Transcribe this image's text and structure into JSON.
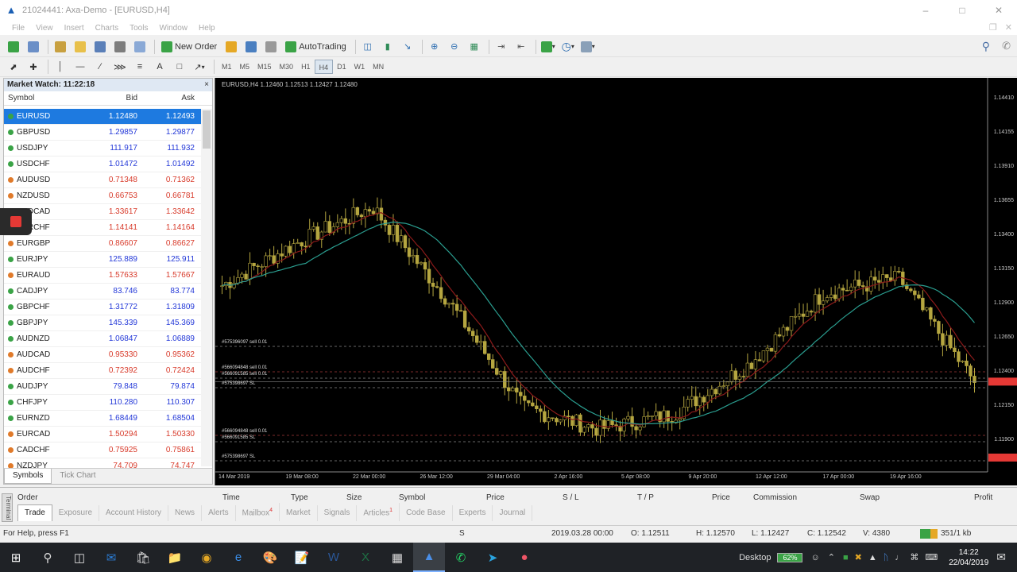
{
  "window": {
    "title": "21024441: Axa-Demo - [EURUSD,H4]",
    "buttons": [
      "–",
      "□",
      "✕"
    ]
  },
  "menu": [
    "File",
    "View",
    "Insert",
    "Charts",
    "Tools",
    "Window",
    "Help"
  ],
  "toolbar": {
    "new_order": "New Order",
    "autotrading": "AutoTrading",
    "timeframes": [
      "M1",
      "M5",
      "M15",
      "M30",
      "H1",
      "H4",
      "D1",
      "W1",
      "MN"
    ],
    "active_timeframe": "H4"
  },
  "market_watch": {
    "title": "Market Watch: 11:22:18",
    "columns": [
      "Symbol",
      "Bid",
      "Ask"
    ],
    "rows": [
      {
        "symbol": "EURUSD",
        "bid": "1.12480",
        "ask": "1.12493",
        "up": true
      },
      {
        "symbol": "GBPUSD",
        "bid": "1.29857",
        "ask": "1.29877",
        "up": true
      },
      {
        "symbol": "USDJPY",
        "bid": "111.917",
        "ask": "111.932",
        "up": true
      },
      {
        "symbol": "USDCHF",
        "bid": "1.01472",
        "ask": "1.01492",
        "up": true
      },
      {
        "symbol": "AUDUSD",
        "bid": "0.71348",
        "ask": "0.71362",
        "up": false
      },
      {
        "symbol": "NZDUSD",
        "bid": "0.66753",
        "ask": "0.66781",
        "up": false
      },
      {
        "symbol": "USDCAD",
        "bid": "1.33617",
        "ask": "1.33642",
        "up": false
      },
      {
        "symbol": "EURCHF",
        "bid": "1.14141",
        "ask": "1.14164",
        "up": false
      },
      {
        "symbol": "EURGBP",
        "bid": "0.86607",
        "ask": "0.86627",
        "up": false
      },
      {
        "symbol": "EURJPY",
        "bid": "125.889",
        "ask": "125.911",
        "up": true
      },
      {
        "symbol": "EURAUD",
        "bid": "1.57633",
        "ask": "1.57667",
        "up": false
      },
      {
        "symbol": "CADJPY",
        "bid": "83.746",
        "ask": "83.774",
        "up": true
      },
      {
        "symbol": "GBPCHF",
        "bid": "1.31772",
        "ask": "1.31809",
        "up": true
      },
      {
        "symbol": "GBPJPY",
        "bid": "145.339",
        "ask": "145.369",
        "up": true
      },
      {
        "symbol": "AUDNZD",
        "bid": "1.06847",
        "ask": "1.06889",
        "up": true
      },
      {
        "symbol": "AUDCAD",
        "bid": "0.95330",
        "ask": "0.95362",
        "up": false
      },
      {
        "symbol": "AUDCHF",
        "bid": "0.72392",
        "ask": "0.72424",
        "up": false
      },
      {
        "symbol": "AUDJPY",
        "bid": "79.848",
        "ask": "79.874",
        "up": true
      },
      {
        "symbol": "CHFJPY",
        "bid": "110.280",
        "ask": "110.307",
        "up": true
      },
      {
        "symbol": "EURNZD",
        "bid": "1.68449",
        "ask": "1.68504",
        "up": true
      },
      {
        "symbol": "EURCAD",
        "bid": "1.50294",
        "ask": "1.50330",
        "up": false
      },
      {
        "symbol": "CADCHF",
        "bid": "0.75925",
        "ask": "0.75861",
        "up": false
      },
      {
        "symbol": "NZDJPY",
        "bid": "74.709",
        "ask": "74.747",
        "up": false
      }
    ],
    "tabs": [
      "Symbols",
      "Tick Chart"
    ],
    "active_tab": "Symbols"
  },
  "chart": {
    "header": "EURUSD,H4  1.12460 1.12513 1.12427 1.12480",
    "y_labels": [
      "1.14410",
      "1.14155",
      "1.13910",
      "1.13655",
      "1.13400",
      "1.13150",
      "1.12900",
      "1.12650",
      "1.12400",
      "1.12150",
      "1.11900"
    ],
    "x_labels": [
      "14 Mar 2019",
      "19 Mar 08:00",
      "22 Mar 00:00",
      "26 Mar 12:00",
      "29 Mar 04:00",
      "2 Apr 16:00",
      "5 Apr 08:00",
      "9 Apr 20:00",
      "12 Apr 12:00",
      "17 Apr 00:00",
      "19 Apr 16:00"
    ],
    "order_labels": [
      "#575396097 sell 0.01",
      "#566094848 sell 0.01",
      "#566091585 sell 0.01",
      "#575398697 SL",
      "#566094848 sell 0.01",
      "#566091585 SL",
      "#575398697 SL"
    ],
    "current_price_color": "#e53935",
    "candle_color": "#b5a640",
    "ma_fast_color": "#8b1a1a",
    "ma_slow_color": "#2a9d8f"
  },
  "chart_data": {
    "type": "line",
    "title": "",
    "symbol": "EURUSD",
    "timeframe": "H4",
    "x": [
      "14 Mar 2019",
      "19 Mar 08:00",
      "22 Mar 00:00",
      "26 Mar 12:00",
      "29 Mar 04:00",
      "2 Apr 16:00",
      "5 Apr 08:00",
      "9 Apr 20:00",
      "12 Apr 12:00",
      "17 Apr 00:00",
      "19 Apr 16:00"
    ],
    "series": [
      {
        "values": [
          1.1315,
          1.1345,
          1.137,
          1.1305,
          1.123,
          1.1215,
          1.1225,
          1.126,
          1.131,
          1.132,
          1.1248
        ]
      }
    ],
    "ylim": [
      1.1185,
      1.145
    ],
    "last_price": 1.1248,
    "grid": false
  },
  "terminal": {
    "side_label": "Terminal",
    "columns": [
      "Order",
      "Time",
      "Type",
      "Size",
      "Symbol",
      "Price",
      "S / L",
      "T / P",
      "Price",
      "Commission",
      "Swap",
      "Profit"
    ],
    "tabs": [
      "Trade",
      "Exposure",
      "Account History",
      "News",
      "Alerts",
      "Mailbox",
      "Market",
      "Signals",
      "Articles",
      "Code Base",
      "Experts",
      "Journal"
    ],
    "active_tab": "Trade",
    "mailbox_badge": "4",
    "articles_badge": "1"
  },
  "status": {
    "help": "For Help, press F1",
    "profile": "S",
    "datetime": "2019.03.28 00:00",
    "open": "O: 1.12511",
    "high": "H: 1.12570",
    "low": "L: 1.12427",
    "close": "C: 1.12542",
    "volume": "V: 4380",
    "traffic": "351/1 kb"
  },
  "taskbar": {
    "desktop": "Desktop",
    "battery": "62%",
    "time": "14:22",
    "date": "22/04/2019"
  }
}
